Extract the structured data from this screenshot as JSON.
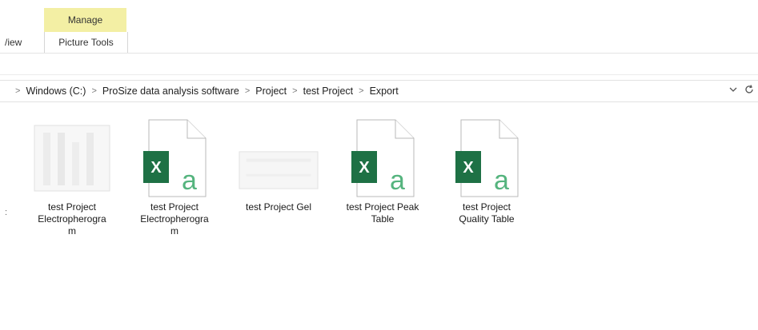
{
  "ribbon": {
    "context_tab": "Manage",
    "view_tab": "/iew",
    "picture_tools_tab": "Picture Tools"
  },
  "address": {
    "nav_prefix": ">",
    "crumbs": [
      "Windows (C:)",
      "ProSize data analysis software",
      "Project",
      "test Project",
      "Export"
    ],
    "separator": ">",
    "dropdown_icon": "chevron-down-icon",
    "refresh_icon": "refresh-icon"
  },
  "files": [
    {
      "name": "test Project Electropherogram",
      "label_lines": [
        "test Project",
        "Electropherogra",
        "m"
      ],
      "type": "image"
    },
    {
      "name": "test Project Electropherogram",
      "label_lines": [
        "test Project",
        "Electropherogra",
        "m"
      ],
      "type": "excel"
    },
    {
      "name": "test Project Gel",
      "label_lines": [
        "test Project Gel"
      ],
      "type": "image"
    },
    {
      "name": "test Project Peak Table",
      "label_lines": [
        "test Project Peak",
        "Table"
      ],
      "type": "excel"
    },
    {
      "name": "test Project Quality Table",
      "label_lines": [
        "test Project",
        "Quality Table"
      ],
      "type": "excel"
    }
  ],
  "icon_glyphs": {
    "excel_letter": "X",
    "excel_doc_letter": "a"
  },
  "colors": {
    "manage_tab_bg": "#f3efa4",
    "excel_green": "#1e7145",
    "excel_letter_green": "#55b47e"
  },
  "left_edge_mark": ":"
}
